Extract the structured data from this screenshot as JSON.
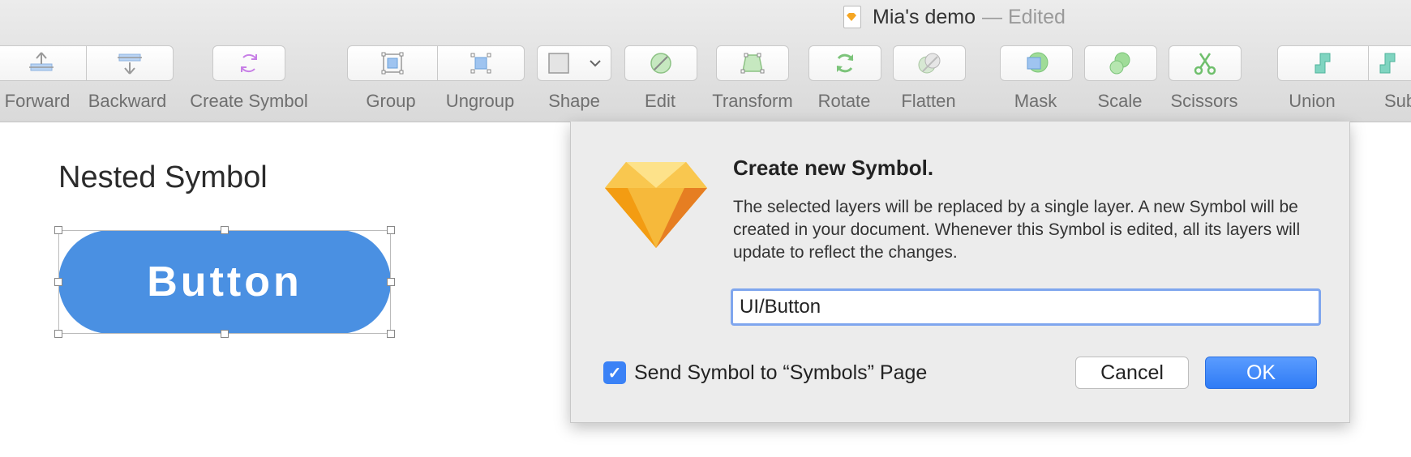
{
  "window": {
    "document_name": "Mia's demo",
    "edited_label": "— Edited"
  },
  "toolbar": {
    "items": [
      {
        "label": "Forward",
        "icon": "bring-forward-icon"
      },
      {
        "label": "Backward",
        "icon": "send-backward-icon"
      },
      {
        "label": "Create Symbol",
        "icon": "create-symbol-icon"
      },
      {
        "label": "Group",
        "icon": "group-icon"
      },
      {
        "label": "Ungroup",
        "icon": "ungroup-icon"
      },
      {
        "label": "Shape",
        "icon": "shape-icon"
      },
      {
        "label": "Edit",
        "icon": "edit-icon"
      },
      {
        "label": "Transform",
        "icon": "transform-icon"
      },
      {
        "label": "Rotate",
        "icon": "rotate-icon"
      },
      {
        "label": "Flatten",
        "icon": "flatten-icon"
      },
      {
        "label": "Mask",
        "icon": "mask-icon"
      },
      {
        "label": "Scale",
        "icon": "scale-icon"
      },
      {
        "label": "Scissors",
        "icon": "scissors-icon"
      },
      {
        "label": "Union",
        "icon": "union-icon"
      },
      {
        "label": "Subtra",
        "icon": "subtract-icon"
      }
    ]
  },
  "canvas": {
    "heading": "Nested Symbol",
    "button_label": "Button",
    "button_color": "#4a90e2"
  },
  "dialog": {
    "title": "Create new Symbol.",
    "message": "The selected layers will be replaced by a single layer. A new Symbol will be created in your document. Whenever this Symbol is edited, all its layers will update to reflect the changes.",
    "input_value": "UI/Button",
    "checkbox_label": "Send Symbol to “Symbols” Page",
    "checkbox_checked": true,
    "cancel_label": "Cancel",
    "ok_label": "OK",
    "accent_color": "#3b82f6"
  }
}
